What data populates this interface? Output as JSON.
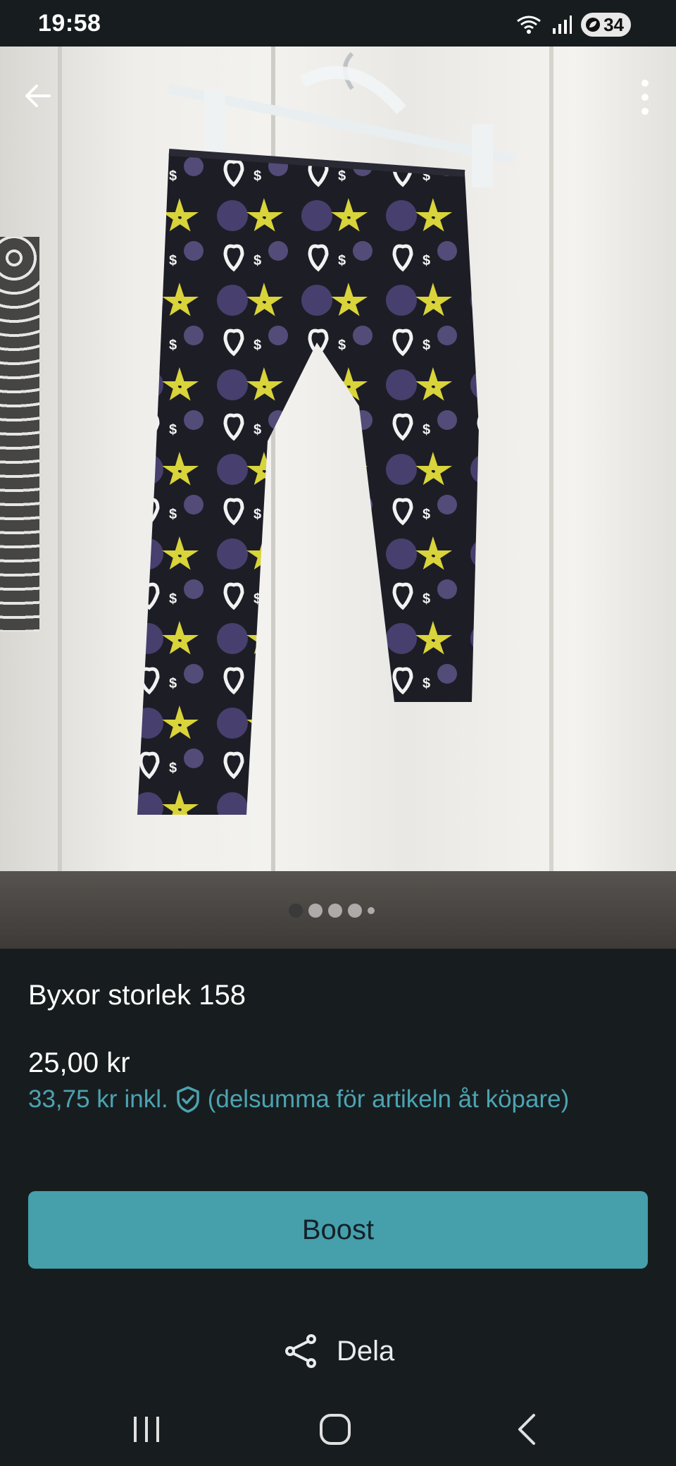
{
  "status_bar": {
    "time": "19:58",
    "battery_level": "34",
    "icons": [
      "wifi-icon",
      "signal-icon",
      "battery-icon"
    ]
  },
  "photo": {
    "image_count_indicator": 5,
    "active_index": 0,
    "icons": {
      "back": "arrow-left-icon",
      "more": "more-vertical-icon"
    }
  },
  "listing": {
    "title": "Byxor storlek 158",
    "price": "25,00 kr",
    "price_incl_amount": "33,75 kr",
    "price_incl_label": "inkl.",
    "price_incl_note": "(delsumma för artikeln åt köpare)"
  },
  "actions": {
    "boost_label": "Boost",
    "share_label": "Dela"
  },
  "colors": {
    "background": "#171d1f",
    "accent": "#45a0ab",
    "accent_text": "#4ca3b1"
  }
}
